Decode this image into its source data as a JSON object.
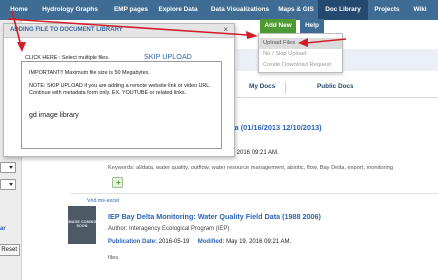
{
  "nav": {
    "items": [
      "Home",
      "Hydrology Graphs",
      "EMP pages",
      "Explore Data",
      "Data Visualizations",
      "Maps & GIS",
      "Doc Library",
      "Projects",
      "Wiki"
    ],
    "active": "Doc Library"
  },
  "add_new": {
    "label": "Add New",
    "help_label": "Help",
    "menu": [
      "Upload Files",
      "No / Skip Upload",
      "Create Download Request"
    ],
    "highlighted": "Upload Files"
  },
  "tabs": [
    "My Docs",
    "Public Docs"
  ],
  "sidebar": {
    "link_fragment": "ar",
    "reset_label": "Reset"
  },
  "modal": {
    "title": "ADDING FILE TO DOCUMENT LIBRARY",
    "close": "×",
    "click_here": "CLICK HERE : Select multiple files.",
    "skip_upload": "SKIP UPLOAD",
    "important": "IMPORTANT!! Maximum file size is 50 Megabytes.",
    "note_line1": "NOTE: SKIP UPLOAD if you are adding a remote website link or video URL.",
    "note_line2": "Continue with metadata form only. EX. YOUTUBE or related links.",
    "library_text": "gd image library"
  },
  "results": [
    {
      "title_fragment": "ld Data (01/16/2013 12/10/2013)",
      "date_fragment": "9, 2016 09:21 AM.",
      "keywords": "Keywords: alldata, water quality, outflow, water resource management, abiotic, flow, Bay Delta, export, monitoring"
    },
    {
      "mime": "Vnd.ms-excel",
      "thumb_text": "IMAGE COMING SOON",
      "title": "IEP Bay Delta Monitoring: Water Quality Field Data (1988 2006)",
      "author": "Author: Interagency Ecological Program (IEP)",
      "pub_label": "Publication Date:",
      "pub_date": "2016-05-19",
      "mod_label": "Modified:",
      "mod_date": "May 19, 2016 09:21 AM.",
      "keywords_fragment": "files."
    }
  ],
  "colors": {
    "nav_bg": "#3f6c94",
    "nav_active": "#234a6e",
    "add_new_green": "#4d9a32",
    "link_blue": "#2a63b6",
    "annotation_red": "#d01f2a"
  }
}
